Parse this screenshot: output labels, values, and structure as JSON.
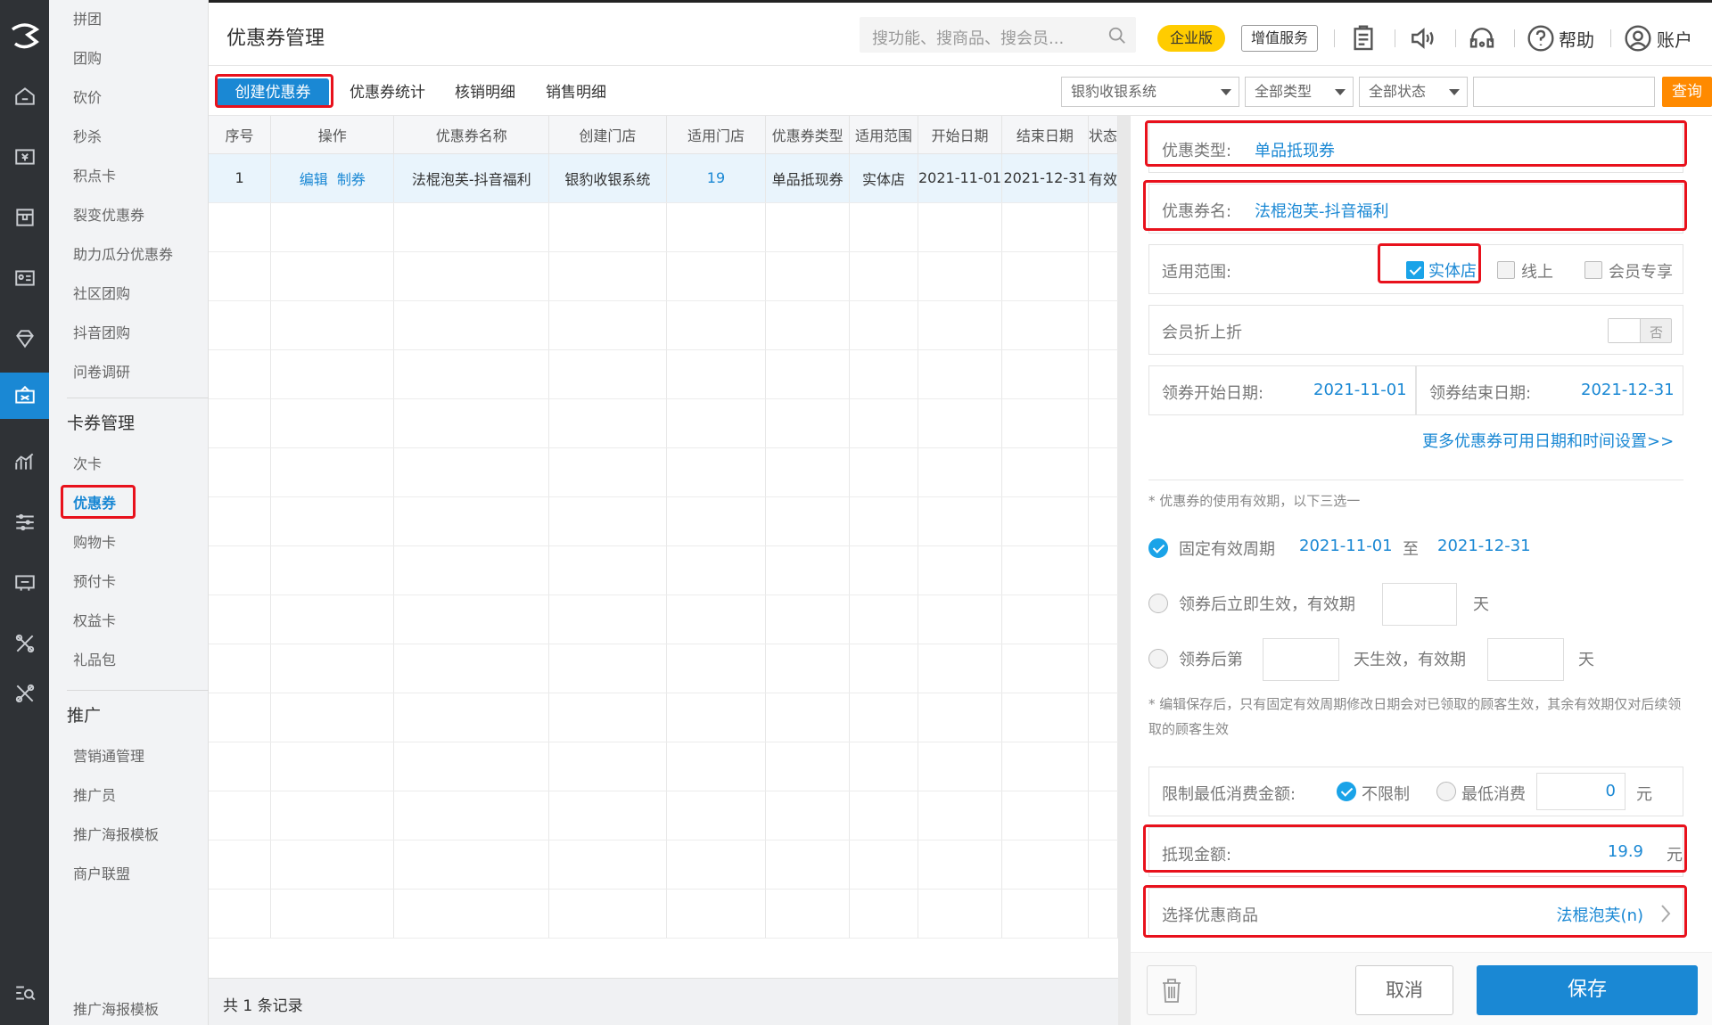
{
  "sidebar_menu": {
    "items_top": [
      "拼团",
      "团购",
      "砍价",
      "秒杀",
      "积点卡",
      "裂变优惠券",
      "助力瓜分优惠券",
      "社区团购",
      "抖音团购",
      "问卷调研"
    ],
    "section_cards": "卡券管理",
    "items_cards": [
      "次卡",
      "优惠券",
      "购物卡",
      "预付卡",
      "权益卡",
      "礼品包"
    ],
    "section_promo": "推广",
    "items_promo": [
      "营销通管理",
      "推广员",
      "推广海报模板",
      "商户联盟"
    ],
    "bottom_item": "推广海报模板"
  },
  "header": {
    "title": "优惠券管理",
    "search_placeholder": "搜功能、搜商品、搜会员...",
    "badge_enterprise": "企业版",
    "btn_value_added": "增值服务",
    "help": "帮助",
    "account": "账户"
  },
  "tabs": {
    "create": "创建优惠券",
    "stats": "优惠券统计",
    "verify_detail": "核销明细",
    "sales_detail": "销售明细"
  },
  "filters": {
    "system": "银豹收银系统",
    "type": "全部类型",
    "status": "全部状态",
    "query": "查询"
  },
  "table": {
    "headers": [
      "序号",
      "操作",
      "优惠券名称",
      "创建门店",
      "适用门店",
      "优惠券类型",
      "适用范围",
      "开始日期",
      "结束日期",
      "状态"
    ],
    "row": {
      "index": "1",
      "op_edit": "编辑",
      "op_make": "制券",
      "name": "法棍泡芙-抖音福利",
      "store": "银豹收银系统",
      "stores_count": "19",
      "type": "单品抵现券",
      "scope": "实体店",
      "start": "2021-11-01",
      "end": "2021-12-31",
      "status": "有效"
    },
    "footer": "共 1 条记录"
  },
  "panel": {
    "type_label": "优惠类型:",
    "type_value": "单品抵现券",
    "name_label": "优惠券名:",
    "name_value": "法棍泡芙-抖音福利",
    "scope_label": "适用范围:",
    "scope_store": "实体店",
    "scope_online": "线上",
    "scope_member": "会员专享",
    "member_discount_label": "会员折上折",
    "member_discount_toggle": "否",
    "claim_start_label": "领券开始日期:",
    "claim_start": "2021-11-01",
    "claim_end_label": "领券结束日期:",
    "claim_end": "2021-12-31",
    "more_settings": "更多优惠券可用日期和时间设置>>",
    "validity_note": "* 优惠券的使用有效期，以下三选一",
    "fixed_label": "固定有效周期",
    "fixed_start": "2021-11-01",
    "fixed_to": "至",
    "fixed_end": "2021-12-31",
    "immediate_label": "领券后立即生效，有效期",
    "day_unit": "天",
    "after_label": "领券后第",
    "after_mid": "天生效，有效期",
    "edit_note": "* 编辑保存后，只有固定有效周期修改日期会对已领取的顾客生效，其余有效期仅对后续领取的顾客生效",
    "min_spend_label": "限制最低消费金额:",
    "no_limit": "不限制",
    "min_spend": "最低消费",
    "min_spend_value": "0",
    "yuan": "元",
    "cash_label": "抵现金额:",
    "cash_value": "19.9",
    "goods_label": "选择优惠商品",
    "goods_value": "法棍泡芙(n)",
    "cancel": "取消",
    "save": "保存"
  }
}
